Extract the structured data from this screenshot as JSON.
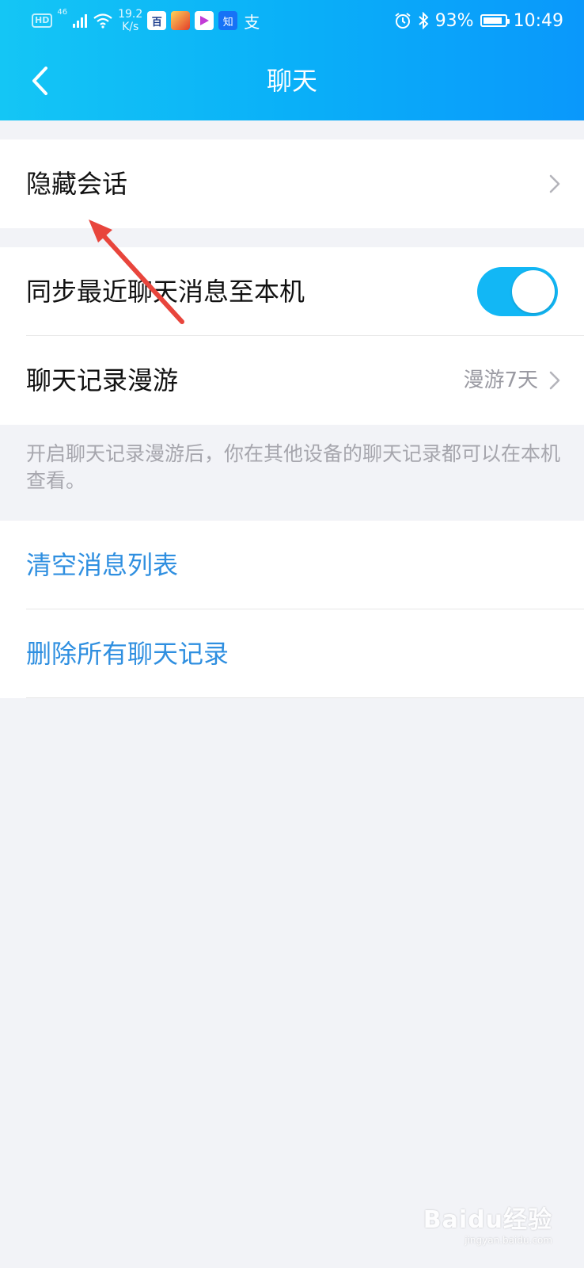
{
  "status_bar": {
    "hd_badge": "HD",
    "network": "46",
    "speed_value": "19.2",
    "speed_unit": "K/s",
    "apps": [
      "百",
      "知",
      "支"
    ],
    "battery_percent": 93,
    "battery_text": "93%",
    "time": "10:49"
  },
  "navbar": {
    "title": "聊天"
  },
  "items": {
    "hidden_chats": "隐藏会话",
    "sync_recent": "同步最近聊天消息至本机",
    "sync_toggle_on": true,
    "roaming": "聊天记录漫游",
    "roaming_value": "漫游7天",
    "roaming_note": "开启聊天记录漫游后，你在其他设备的聊天记录都可以在本机查看。",
    "clear_list": "清空消息列表",
    "delete_all": "删除所有聊天记录"
  },
  "watermark": {
    "brand": "Baidu经验",
    "url": "jingyan.baidu.com"
  },
  "colors": {
    "accent": "#12b7f5",
    "link_blue": "#2f8fe0",
    "annotation_red": "#e8453c"
  }
}
